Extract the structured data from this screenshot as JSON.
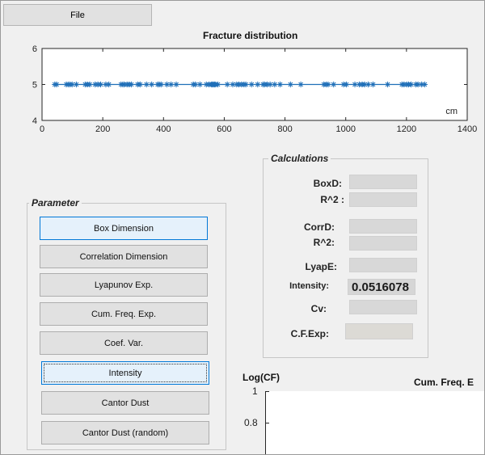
{
  "menu": {
    "file_label": "File"
  },
  "chart_data": {
    "type": "scatter",
    "title": "Fracture distribution",
    "xlabel": "cm",
    "ylabel": "",
    "xlim": [
      0,
      1400
    ],
    "ylim": [
      4,
      6
    ],
    "x_ticks": [
      "0",
      "200",
      "400",
      "600",
      "800",
      "1000",
      "1200",
      "1400"
    ],
    "y_ticks": [
      "4",
      "5",
      "6"
    ],
    "marker": "*",
    "line": true,
    "color": "#1f6fb8",
    "series": [
      {
        "x": [
          42,
          48,
          80,
          86,
          92,
          99,
          113,
          142,
          149,
          157,
          175,
          184,
          193,
          210,
          220,
          260,
          266,
          271,
          280,
          287,
          294,
          315,
          323,
          344,
          361,
          381,
          386,
          392,
          411,
          425,
          442,
          498,
          505,
          520,
          541,
          550,
          557,
          561,
          564,
          568,
          572,
          579,
          610,
          628,
          641,
          648,
          657,
          665,
          671,
          690,
          710,
          728,
          733,
          741,
          751,
          766,
          784,
          818,
          852,
          928,
          936,
          942,
          960,
          993,
          1002,
          1030,
          1045,
          1054,
          1062,
          1074,
          1090,
          1138,
          1185,
          1192,
          1201,
          1207,
          1215,
          1231,
          1238,
          1250,
          1260
        ],
        "y": [
          5,
          5,
          5,
          5,
          5,
          5,
          5,
          5,
          5,
          5,
          5,
          5,
          5,
          5,
          5,
          5,
          5,
          5,
          5,
          5,
          5,
          5,
          5,
          5,
          5,
          5,
          5,
          5,
          5,
          5,
          5,
          5,
          5,
          5,
          5,
          5,
          5,
          5,
          5,
          5,
          5,
          5,
          5,
          5,
          5,
          5,
          5,
          5,
          5,
          5,
          5,
          5,
          5,
          5,
          5,
          5,
          5,
          5,
          5,
          5,
          5,
          5,
          5,
          5,
          5,
          5,
          5,
          5,
          5,
          5,
          5,
          5,
          5,
          5,
          5,
          5,
          5,
          5,
          5,
          5,
          5
        ]
      }
    ]
  },
  "parameter": {
    "title": "Parameter",
    "buttons": [
      {
        "label": "Box Dimension"
      },
      {
        "label": "Correlation Dimension"
      },
      {
        "label": "Lyapunov Exp."
      },
      {
        "label": "Cum. Freq. Exp."
      },
      {
        "label": "Coef. Var."
      },
      {
        "label": "Intensity"
      },
      {
        "label": "Cantor Dust"
      },
      {
        "label": "Cantor Dust (random)"
      }
    ]
  },
  "calculations": {
    "title": "Calculations",
    "boxd_label": "BoxD:",
    "r2_box_label": "R^2 :",
    "corrd_label": "CorrD:",
    "r2_corr_label": "R^2:",
    "lyape_label": "LyapE:",
    "intensity_label": "Intensity:",
    "intensity_value": "0.0516078",
    "cv_label": "Cv:",
    "cfexp_label": "C.F.Exp:"
  },
  "cumfreq_plot": {
    "ylabel": "Log(CF)",
    "title": "Cum. Freq. E",
    "y_ticks": [
      "1",
      "0.8"
    ]
  }
}
